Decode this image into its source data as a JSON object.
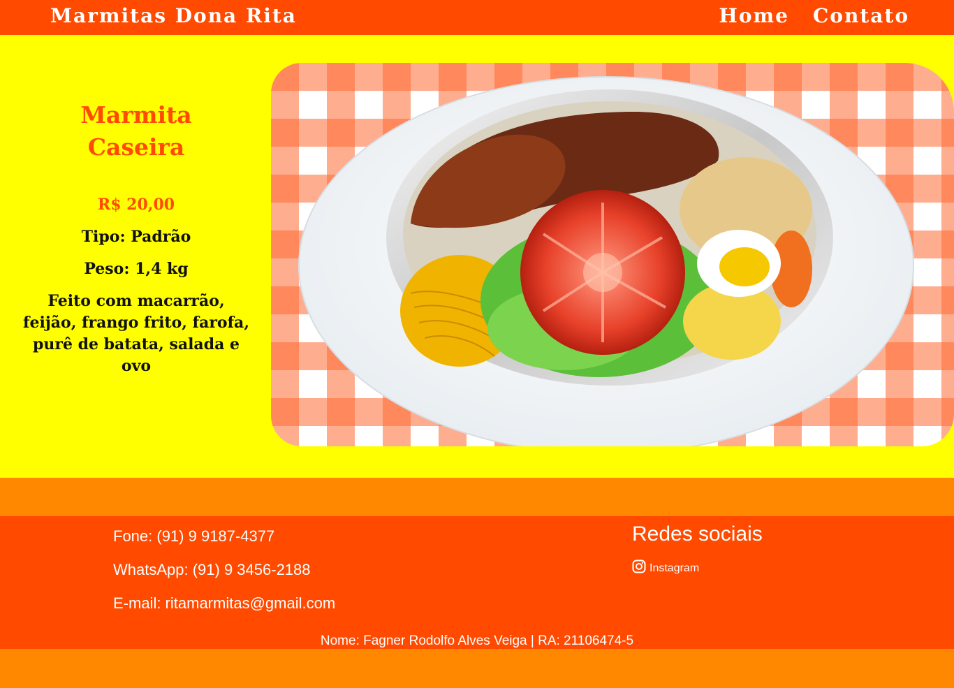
{
  "header": {
    "brand": "Marmitas Dona Rita",
    "nav": [
      {
        "label": "Home"
      },
      {
        "label": "Contato"
      }
    ]
  },
  "product": {
    "title": "Marmita Caseira",
    "price": "R$ 20,00",
    "type": "Tipo: Padrão",
    "weight": "Peso: 1,4 kg",
    "description": "Feito com macarrão, feijão, frango frito, farofa, purê de batata, salada e ovo"
  },
  "footer": {
    "phone": "Fone: (91) 9 9187-4377",
    "whatsapp": "WhatsApp: (91) 9 3456-2188",
    "email": "E-mail: ritamarmitas@gmail.com",
    "social_title": "Redes sociais",
    "instagram_label": "Instagram",
    "instagram_icon": "instagram-icon",
    "credit": "Nome: Fagner Rodolfo Alves Veiga | RA: 21106474-5"
  },
  "colors": {
    "header_bg": "#ff4a00",
    "main_bg": "#ffff00",
    "accent_text": "#ff4a00",
    "band_bg": "#ff8800",
    "footer_bg": "#ff4a00"
  }
}
